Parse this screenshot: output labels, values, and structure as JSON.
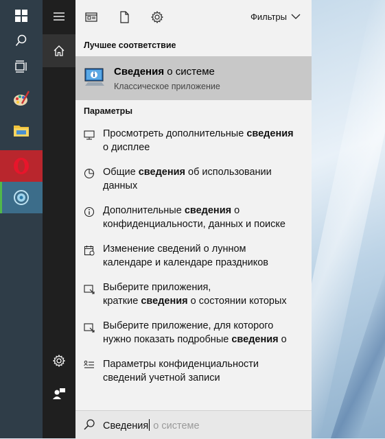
{
  "taskbar": {
    "items": [
      {
        "name": "windows-start"
      },
      {
        "name": "search"
      },
      {
        "name": "task-view"
      },
      {
        "name": "paint-app"
      },
      {
        "name": "file-explorer"
      },
      {
        "name": "opera-browser",
        "active": true,
        "color": "#b9262d"
      },
      {
        "name": "system-info-app",
        "active": true,
        "color": "#3c6d8a"
      }
    ]
  },
  "topbar": {
    "filters_label": "Фильтры"
  },
  "best_match": {
    "heading": "Лучшее соответствие",
    "title_bold": "Сведения",
    "title_rest": " о системе",
    "subtitle": "Классическое приложение"
  },
  "settings": {
    "heading": "Параметры",
    "items": [
      {
        "icon": "monitor-icon",
        "parts": [
          "Просмотреть дополнительные ",
          "сведения",
          "\nо дисплее"
        ]
      },
      {
        "icon": "pie-chart-icon",
        "parts": [
          "Общие ",
          "сведения",
          " об использовании\nданных"
        ]
      },
      {
        "icon": "info-icon",
        "parts": [
          "Дополнительные ",
          "сведения",
          " о\nконфиденциальности, данных и поиске"
        ]
      },
      {
        "icon": "calendar-icon",
        "parts": [
          "Изменение сведений о лунном\nкалендаре и календаре праздников",
          "",
          ""
        ]
      },
      {
        "icon": "notification-icon",
        "parts": [
          "Выберите приложения,\nкраткие ",
          "сведения",
          " о состоянии которых"
        ]
      },
      {
        "icon": "notification-icon",
        "parts": [
          "Выберите приложение, для которого\nнужно показать подробные ",
          "сведения",
          " о"
        ]
      },
      {
        "icon": "account-list-icon",
        "parts": [
          "Параметры конфиденциальности\nсведений учетной записи",
          "",
          ""
        ]
      }
    ]
  },
  "search": {
    "typed": "Сведения",
    "suggestion": " о системе"
  }
}
